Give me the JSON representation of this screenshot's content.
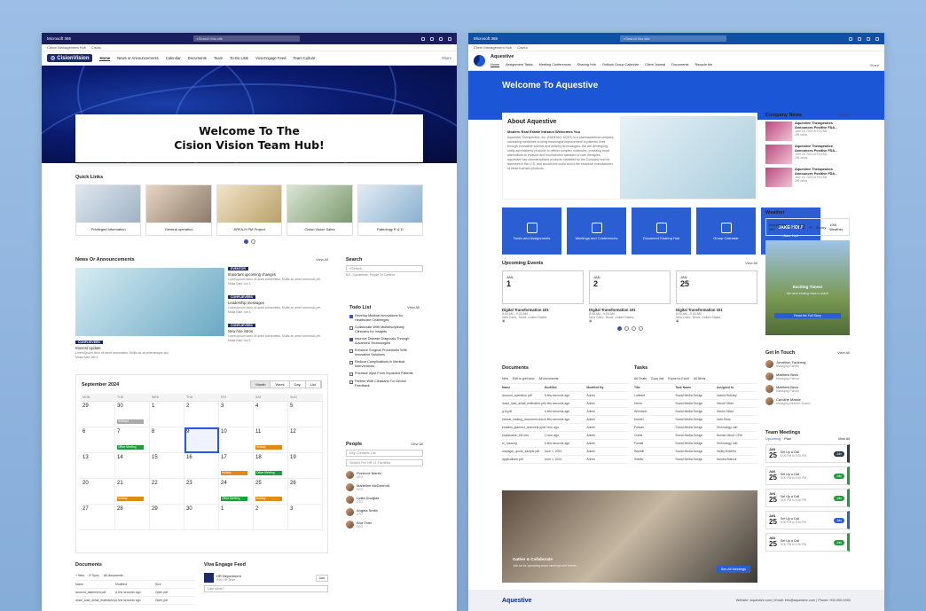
{
  "win1": {
    "bar": {
      "app": "Microsoft 365",
      "search": "Search this site"
    },
    "crumb": [
      "Cision Management Hub",
      "Cision"
    ],
    "logo": "CisionVision",
    "nav": [
      "Home",
      "News or Announcements",
      "Calendar",
      "Documents",
      "Team",
      "To-Do Lists",
      "Viva Engage Feed",
      "Team Culture"
    ],
    "share": "Share",
    "welcome1": "Welcome To The",
    "welcome2": "Cision Vision Team Hub!",
    "quick_links_title": "Quick Links",
    "quick_links": [
      "Privileged Information",
      "General operation",
      "JIRFA-H PM Project",
      "Cision Vision Sales",
      "Pathology R & D"
    ],
    "news_title": "News Or Announcements",
    "view_all": "View All",
    "news_main": {
      "tag": "CONFLIEVERS",
      "title": "Interest Update",
      "body": "Lorem ipsum dolor sit amet consectetur. Mollis ac sit pellentesque acc.",
      "author": "Mosa Kate  Jan 3"
    },
    "news_items": [
      {
        "tag": "EVENTOR",
        "title": "Important upcoming changes",
        "body": "Lorem ipsum dolor sit amet consectetur. Mollis ac amet commodo pel.",
        "author": "Mosa Kate  Jun 3"
      },
      {
        "tag": "CONFLIEVERS",
        "title": "Leadership messages",
        "body": "Lorem ipsum dolor sit amet consectetur. Mollis ac amet commodo pel.",
        "author": "Mosa Kate  Jun 3"
      },
      {
        "tag": "CONFLIEVERS",
        "title": "New hire intros",
        "body": "Lorem ipsum dolor sit amet consectetur. Mollis ac amet commodo pel.",
        "author": "Mosa Kate  Jun 3"
      }
    ],
    "calendar": {
      "month": "September 2024",
      "tabs": [
        "Month",
        "Week",
        "Day",
        "List"
      ],
      "days": [
        "MON",
        "TUE",
        "WED",
        "THU",
        "FRI",
        "SAT",
        "SUN"
      ],
      "cells": [
        "29",
        "30",
        "1",
        "2",
        "3",
        "4",
        "5",
        "6",
        "7",
        "8",
        "9",
        "10",
        "11",
        "12",
        "13",
        "14",
        "15",
        "16",
        "17",
        "18",
        "19",
        "20",
        "21",
        "22",
        "23",
        "24",
        "25",
        "26",
        "27",
        "28",
        "29",
        "30",
        "1",
        "2",
        "3"
      ],
      "events": {
        "1": "Holidays",
        "8": "Office Meeting",
        "12": "Holiday",
        "18": "Holiday",
        "19": "Office Meeting",
        "22": "Holiday",
        "25": "Office Meeting",
        "26": "Holiday"
      }
    },
    "search": {
      "title": "Search",
      "placeholder": "Search...",
      "hint": "N.E, Documents, People Or Content"
    },
    "todo": {
      "title": "Todo List",
      "view": "View All",
      "items": [
        {
          "t": "Develop Medical Innovations for Healthcare Challenges",
          "c": true
        },
        {
          "t": "Collaborate With Multidisciplinary Clinicians for Insights",
          "c": false
        },
        {
          "t": "Improve Disease Diagnosis Through Advanced Technologies",
          "c": true
        },
        {
          "t": "Enhance Surgical Procedures With Innovative Solutions",
          "c": false
        },
        {
          "t": "Reduce Complications In Medical Interventions",
          "c": false
        },
        {
          "t": "Prioritize Input From Impacted Patients",
          "c": false
        },
        {
          "t": "Partner With Clinicians For Device Feedback",
          "c": false
        }
      ]
    },
    "people": {
      "title": "People",
      "view": "View All",
      "f1": "Key Contacts List",
      "f2": "Search For HR 21 Facilities",
      "list": [
        {
          "n": "Florence Martin",
          "r": "CEO"
        },
        {
          "n": "Madeline McDermott",
          "r": "CFO"
        },
        {
          "n": "Lydia Douglas",
          "r": "CTO"
        },
        {
          "n": "Angela Smith",
          "r": "CTO"
        },
        {
          "n": "Ana Thiel",
          "r": "CEO"
        }
      ]
    },
    "docs_title": "Documents",
    "docs_cols": [
      "Name",
      "Modified",
      "Size"
    ],
    "docs": [
      {
        "n": "account_statement.pdf",
        "m": "A few seconds ago",
        "s": "Open.pdf"
      },
      {
        "n": "down_load_detail_estimated.pdf",
        "m": "A few seconds ago",
        "s": "Open.pdf"
      }
    ],
    "viva_title": "Viva Engage Feed",
    "viva": {
      "from": "HR Department",
      "sub": "Post HR Team",
      "btn": "Join",
      "prompt": "Late what?"
    }
  },
  "win2": {
    "bar": {
      "app": "Microsoft 365",
      "search": "Search this site"
    },
    "crumb": [
      "Client Management Hub",
      "Cisera"
    ],
    "title": "Aquestive",
    "nav": [
      "Home",
      "Assignment Tasks",
      "Meeting Conferences",
      "Sharing Hub",
      "Outlook Group Calendar",
      "Client Journal",
      "Documents",
      "Recycle bin"
    ],
    "share": "Share",
    "welcome": "Welcome To Aquestive",
    "about": {
      "title": "About Aquestive",
      "sub": "Modern Real Estate Intranet Welcomes You",
      "body": "Aquestive Therapeutics, Inc. (NASDAQ: AQST) is a pharmaceutical company advancing medicines to bring meaningful improvement to patients' lives through innovative science and delivery technologies. We are developing orally administered products to deliver complex molecules, providing novel alternatives to invasive and inconvenient standard of care therapies. Aquestive has commercialized products marketed by the Company and its licensees in the U.S. and around the world and is the exclusive manufacturer of these licensed products."
    },
    "tiles": [
      "Tasks and Assignments",
      "Meetings and Conferences",
      "Document Sharing Hub",
      "Group Calendar",
      "Jake Holt"
    ],
    "tile_brand": "JAKE HOLT",
    "events_title": "Upcoming Events",
    "events_view": "View All",
    "events": [
      {
        "m": "JAN",
        "d": "1",
        "t": "Digital Transformation 101",
        "time": "8:00 AM - 9:00 AM",
        "loc": "New Cairo, Texas, United States"
      },
      {
        "m": "JAN",
        "d": "2",
        "t": "Digital Transformation 101",
        "time": "8:00 AM - 9:00 AM",
        "loc": "New Cairo, Texas, United States"
      },
      {
        "m": "JAN",
        "d": "25",
        "t": "Digital Transformation 101",
        "time": "8:00 AM - 9:00 AM",
        "loc": "New Cairo, Texas, United States"
      }
    ],
    "docs_title": "Documents",
    "docs_bar": [
      "New",
      "Edit in grid view",
      "All documents"
    ],
    "docs_cols": [
      "Name",
      "Modified",
      "Modified By"
    ],
    "docs": [
      {
        "n": "account_operation.pdf",
        "m": "A few seconds ago",
        "b": "Admin"
      },
      {
        "n": "down_load_detail_estimated.pdf",
        "m": "A few seconds ago",
        "b": "Admin"
      },
      {
        "n": "g-is.pdf",
        "m": "A few seconds ago",
        "b": "Admin"
      },
      {
        "n": "educat_making_document.docx",
        "m": "A few seconds ago",
        "b": "Admin"
      },
      {
        "n": "enables_planned_channels.pptx",
        "m": "1 hour ago",
        "b": "Admin"
      },
      {
        "n": "explanation_file.xlsx",
        "m": "1 hour ago",
        "b": "Admin"
      },
      {
        "n": "m_housing",
        "m": "A few seconds ago",
        "b": "Admin"
      },
      {
        "n": "manager_quote_sample.pdf",
        "m": "June 1, 2024",
        "b": "Admin"
      },
      {
        "n": "applications.pdf",
        "m": "June 1, 2024",
        "b": "Admin"
      }
    ],
    "tasks_title": "Tasks",
    "tasks_bar": [
      "All Chats",
      "Copy link",
      "Export to Excel",
      "All Items"
    ],
    "tasks_cols": [
      "Title",
      "Task Name",
      "Assigned to"
    ],
    "tasks": [
      {
        "a": "Lorikeet",
        "b": "Social Media Design",
        "c": "Indoria Rubaby"
      },
      {
        "a": "Heron",
        "b": "Social Media Design",
        "c": "Harold Silver"
      },
      {
        "a": "Whimbrel",
        "b": "Social Media Design",
        "c": "Harold Silver"
      },
      {
        "a": "Kestrel",
        "b": "Social Media Design",
        "c": "Jade Ross"
      },
      {
        "a": "Pelican",
        "b": "Social Media Design",
        "c": "Technology Lab"
      },
      {
        "a": "Grebe",
        "b": "Social Media Design",
        "c": "Bonnie Vance CFM"
      },
      {
        "a": "Fantail",
        "b": "Social Media Design",
        "c": "Technology Lab"
      },
      {
        "a": "Weebill",
        "b": "Social Media Design",
        "c": "Halley Roberts"
      },
      {
        "a": "Sittella",
        "b": "Social Media Design",
        "c": "Sandra Bullock"
      }
    ],
    "promo": {
      "title": "Gather & Collaborate",
      "sub": "Join us for upcoming team meetings and events",
      "btn": "See All Meetings"
    },
    "news_title": "Company News",
    "news_view": "View All",
    "news": [
      {
        "t": "Aquestive Therapeutics Announces Positive FDA...",
        "d": "June 18, 2024 at 9:00 AM",
        "s": "296 views"
      },
      {
        "t": "Aquestive Therapeutics Announces Positive FDA...",
        "d": "June 18, 2024 at 9:00 AM",
        "s": "296 views"
      },
      {
        "t": "Aquestive Therapeutics Announces Positive FDA...",
        "d": "June 18, 2024 at 9:00 AM",
        "s": "296 views"
      }
    ],
    "weather_title": "Weather",
    "weather": {
      "loc": "Dorchester, NH",
      "temp": "72",
      "unit": "°F",
      "cond": "Sunny",
      "note": "10th Weather"
    },
    "promo2": {
      "title": "Exciting Times!",
      "sub": "We have exciting news to share!",
      "btn": "Read the Full Story"
    },
    "touch_title": "Get In Touch",
    "touch_view": "View All",
    "touch": [
      {
        "n": "Jonathon Faulberg",
        "r": "Managing Partner"
      },
      {
        "n": "Matthew Beck",
        "r": "Managing Partner"
      },
      {
        "n": "Matthew Beck",
        "r": "Managing Partner"
      },
      {
        "n": "Caroline Masse",
        "r": "Managing Director, Boston"
      }
    ],
    "meet_title": "Team Meetings",
    "meet_tabs": [
      "Upcoming",
      "Past"
    ],
    "meet_view": "View All",
    "meetings": [
      {
        "m": "JAN",
        "d": "25",
        "t": "Set Up a Call",
        "time": "5:00 PM to 5:30 PM",
        "btn": "Join",
        "c": "#2e3a4a"
      },
      {
        "m": "JAN",
        "d": "25",
        "t": "Set Up a Call",
        "time": "5:00 PM to 5:30 PM",
        "btn": "Join",
        "c": "#1e9e3a"
      },
      {
        "m": "JAN",
        "d": "25",
        "t": "Set Up a Call",
        "time": "5:00 PM to 5:30 PM",
        "btn": "Join",
        "c": "#1e9e3a"
      },
      {
        "m": "JAN",
        "d": "25",
        "t": "Set Up a Call",
        "time": "5:00 PM to 5:30 PM",
        "btn": "Join",
        "c": "#2a5ed2"
      },
      {
        "m": "JAN",
        "d": "25",
        "t": "Set Up a Call",
        "time": "5:00 PM to 5:30 PM",
        "btn": "Join",
        "c": "#1e9e3a"
      }
    ],
    "footer": {
      "logo": "Aquestive",
      "info": "Website: aquestive.com | Email: info@aquestive.com | Phone: 000-000-0000"
    }
  }
}
